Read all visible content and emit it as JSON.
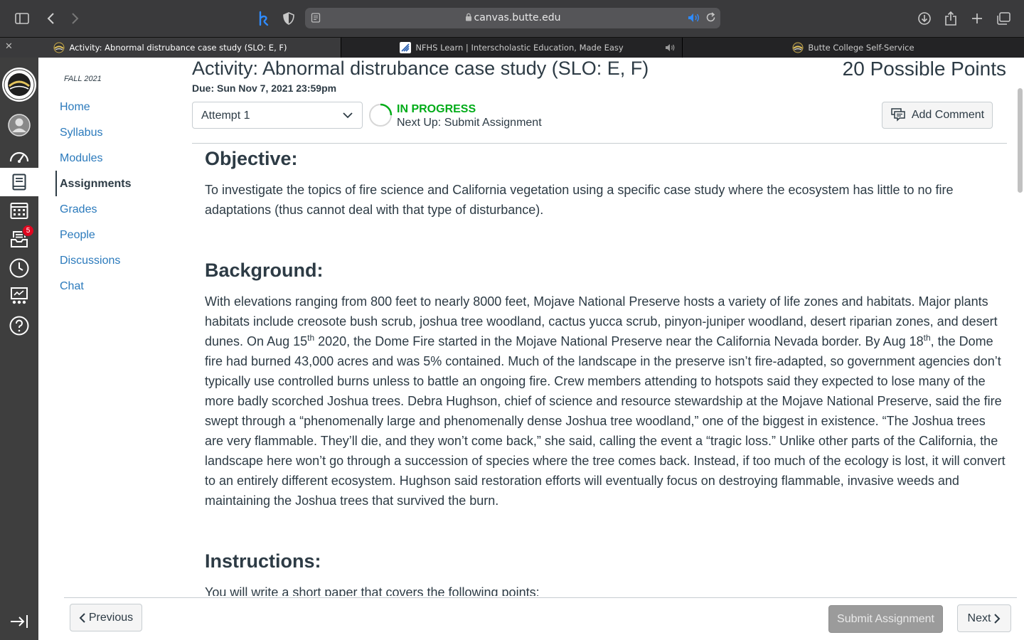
{
  "browser": {
    "url": "canvas.butte.edu",
    "tabs": [
      {
        "label": "Activity: Abnormal distrubance case study (SLO: E, F)",
        "active": true
      },
      {
        "label": "NFHS Learn | Interscholastic Education, Made Easy",
        "active": false,
        "audio": true
      },
      {
        "label": "Butte College Self-Service",
        "active": false
      }
    ]
  },
  "global_nav": {
    "items": [
      "college-logo",
      "account",
      "dashboard",
      "courses",
      "calendar",
      "inbox",
      "history",
      "studio",
      "help"
    ],
    "inbox_badge": "5",
    "active": "courses"
  },
  "course_nav": {
    "term": "FALL 2021",
    "items": [
      {
        "label": "Home"
      },
      {
        "label": "Syllabus"
      },
      {
        "label": "Modules"
      },
      {
        "label": "Assignments",
        "active": true
      },
      {
        "label": "Grades"
      },
      {
        "label": "People"
      },
      {
        "label": "Discussions"
      },
      {
        "label": "Chat"
      }
    ]
  },
  "assignment": {
    "title": "Activity: Abnormal distrubance case study (SLO: E, F)",
    "points": "20 Possible Points",
    "due": "Due: Sun Nov 7, 2021 23:59pm",
    "attempt": "Attempt 1",
    "status": "IN PROGRESS",
    "next_up": "Next Up: Submit Assignment",
    "add_comment": "Add Comment"
  },
  "content": {
    "objective_heading": "Objective:",
    "objective_text": "To investigate the topics of fire science and California vegetation using a specific case study where the ecosystem has little to no fire adaptations (thus cannot deal with that type of disturbance).",
    "background_heading": "Background:",
    "background_1": "With elevations ranging from 800 feet to nearly 8000 feet, Mojave National Preserve hosts a variety of life zones and habitats. Major plants habitats include creosote bush scrub, joshua tree woodland, cactus yucca scrub, pinyon-juniper woodland, desert riparian zones, and desert dunes. On Aug 15",
    "background_sup_1": "th",
    "background_2": " 2020, the Dome Fire started in the Mojave National Preserve near the California Nevada border. By Aug 18",
    "background_sup_2": "th",
    "background_3": ", the Dome fire had burned 43,000 acres and was 5% contained. Much of the landscape in the preserve isn’t fire-adapted, so government agencies don’t typically use controlled burns unless to battle an ongoing fire. Crew members attending to hotspots said they expected to lose many of the more badly scorched Joshua trees. Debra Hughson, chief of science and resource stewardship at the Mojave National Preserve, said the fire swept through a “phenomenally large and phenomenally dense Joshua tree woodland,” one of the biggest in existence. “The Joshua trees are very flammable. They’ll die, and they won’t come back,” she said, calling the event a “tragic loss.” Unlike other parts of the California, the landscape here won’t go through a succession of species where the tree comes back. Instead, if too much of the ecology is lost, it will convert to an entirely different ecosystem. Hughson said restoration efforts will eventually focus on destroying flammable, invasive weeds and maintaining the Joshua trees that survived the burn.",
    "instructions_heading": "Instructions:",
    "instructions_text": "You will write a short paper that covers the following points:"
  },
  "footer": {
    "previous": "Previous",
    "submit": "Submit Assignment",
    "next": "Next"
  },
  "colors": {
    "link": "#2b7abc",
    "text": "#2d3b45",
    "status_green": "#00ac18",
    "nav_bg": "#3e3e3e",
    "badge": "#e0061f"
  }
}
